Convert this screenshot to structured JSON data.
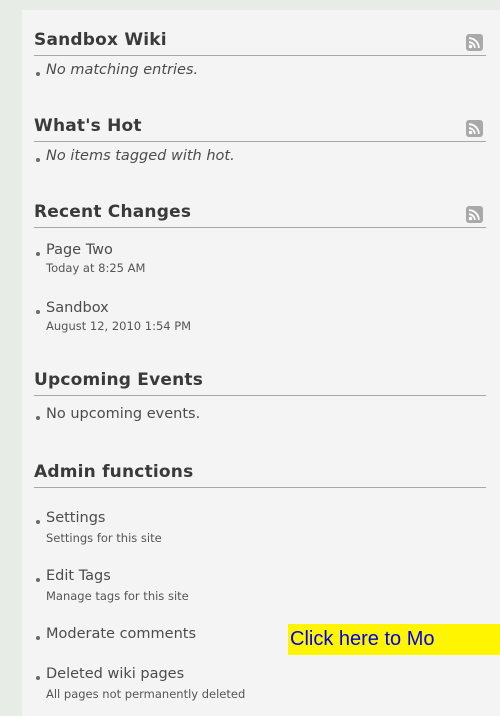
{
  "sections": [
    {
      "title": "Sandbox Wiki",
      "has_rss": true,
      "items": [
        {
          "title": "No matching entries.",
          "italic": true
        }
      ]
    },
    {
      "title": "What's Hot",
      "has_rss": true,
      "items": [
        {
          "title": "No items tagged with hot.",
          "italic": true
        }
      ]
    },
    {
      "title": "Recent Changes",
      "has_rss": true,
      "items": [
        {
          "title": "Page Two",
          "subtitle": "Today at 8:25 AM"
        },
        {
          "title": "Sandbox",
          "subtitle": "August 12, 2010 1:54 PM"
        }
      ]
    },
    {
      "title": "Upcoming Events",
      "has_rss": false,
      "items": [
        {
          "title": "No upcoming events."
        }
      ]
    },
    {
      "title": "Admin functions",
      "has_rss": false,
      "items": [
        {
          "title": "Settings",
          "subtitle": "Settings for this site"
        },
        {
          "title": "Edit Tags",
          "subtitle": "Manage tags for this site"
        },
        {
          "title": "Moderate comments"
        },
        {
          "title": "Deleted wiki pages",
          "subtitle": "All pages not permanently deleted"
        }
      ]
    }
  ],
  "callout": {
    "label": "Click here to Mo"
  },
  "icons": {
    "rss": "rss-feed-icon",
    "bullet": "bullet-icon"
  },
  "colors": {
    "background": "#e7ece7",
    "panel": "#f4f4f4",
    "callout_bg": "#fff500",
    "callout_text": "#0000ee"
  }
}
